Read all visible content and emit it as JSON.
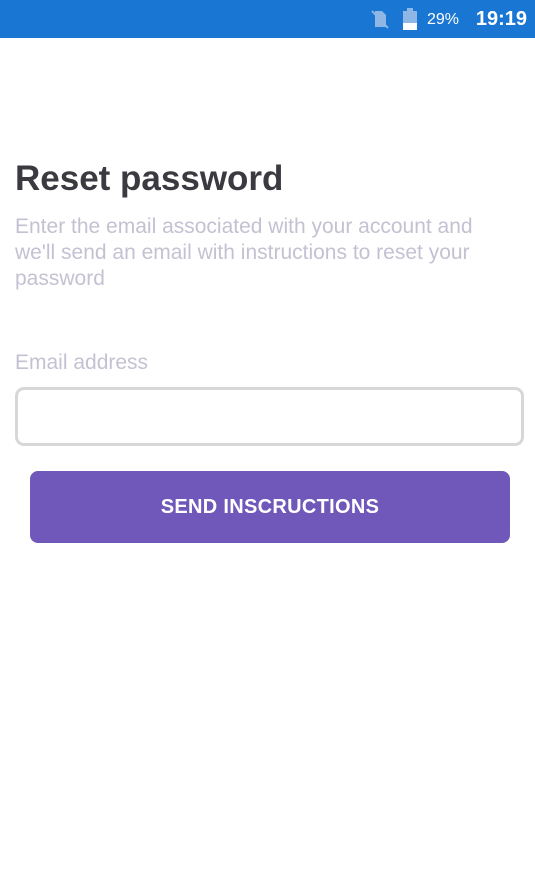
{
  "status_bar": {
    "battery_percent": "29%",
    "time": "19:19",
    "background_color": "#1976d2",
    "icons": [
      "no-sim-icon",
      "battery-icon"
    ]
  },
  "main": {
    "title": "Reset password",
    "subtitle": "Enter the email associated with your account and we'll send an email with instructions to reset your password",
    "email_label": "Email address",
    "email_value": "",
    "send_button_label": "SEND INSCRUCTIONS"
  },
  "colors": {
    "accent": "#6f58b9",
    "title": "#3a3a40",
    "muted_text": "#c5c1d2",
    "input_border": "#d7d7d7"
  }
}
